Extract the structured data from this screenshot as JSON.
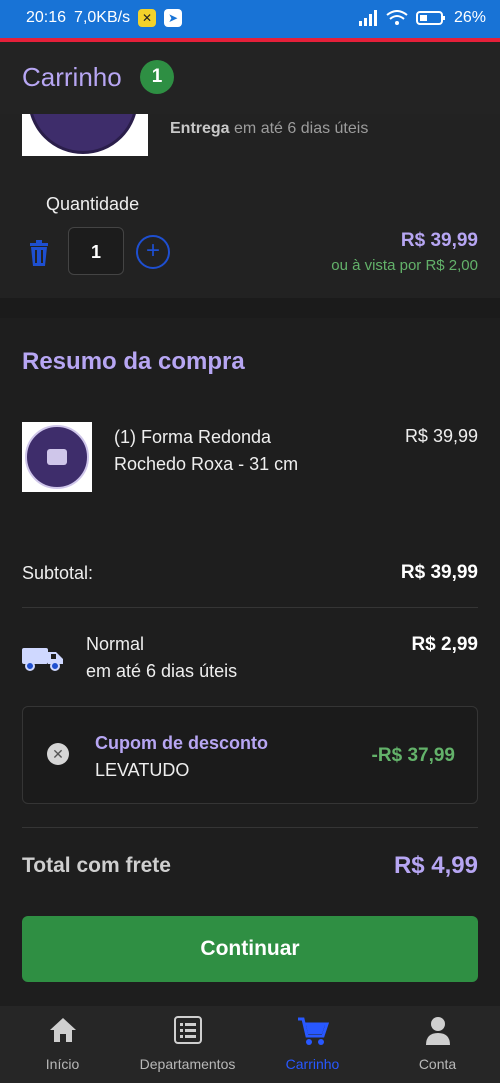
{
  "status_bar": {
    "time": "20:16",
    "speed": "7,0KB/s",
    "battery": "26"
  },
  "header": {
    "title": "Carrinho",
    "badge_count": "1"
  },
  "product": {
    "delivery_prefix": "Entrega",
    "delivery_text": "em até 6 dias úteis",
    "quantity_label": "Quantidade",
    "quantity_value": "1",
    "price": "R$ 39,99",
    "cash_price": "ou à vista por R$ 2,00"
  },
  "summary": {
    "title": "Resumo da compra",
    "item_line1": "(1) Forma Redonda",
    "item_line2": "Rochedo Roxa - 31 cm",
    "item_price": "R$ 39,99",
    "subtotal_label": "Subtotal:",
    "subtotal_value": "R$ 39,99",
    "shipping_name": "Normal",
    "shipping_time": "em até 6 dias úteis",
    "shipping_price": "R$ 2,99",
    "coupon_title": "Cupom de desconto",
    "coupon_code": "LEVATUDO",
    "coupon_value": "-R$ 37,99",
    "total_label": "Total com frete",
    "total_value": "R$ 4,99",
    "continue_label": "Continuar"
  },
  "nav": {
    "items": [
      {
        "label": "Início",
        "icon": "home-icon"
      },
      {
        "label": "Departamentos",
        "icon": "list-icon"
      },
      {
        "label": "Carrinho",
        "icon": "cart-icon"
      },
      {
        "label": "Conta",
        "icon": "user-icon"
      }
    ]
  },
  "colors": {
    "accent": "#b7a6f3",
    "green": "#2f8f43",
    "nav_active": "#2858ff"
  }
}
